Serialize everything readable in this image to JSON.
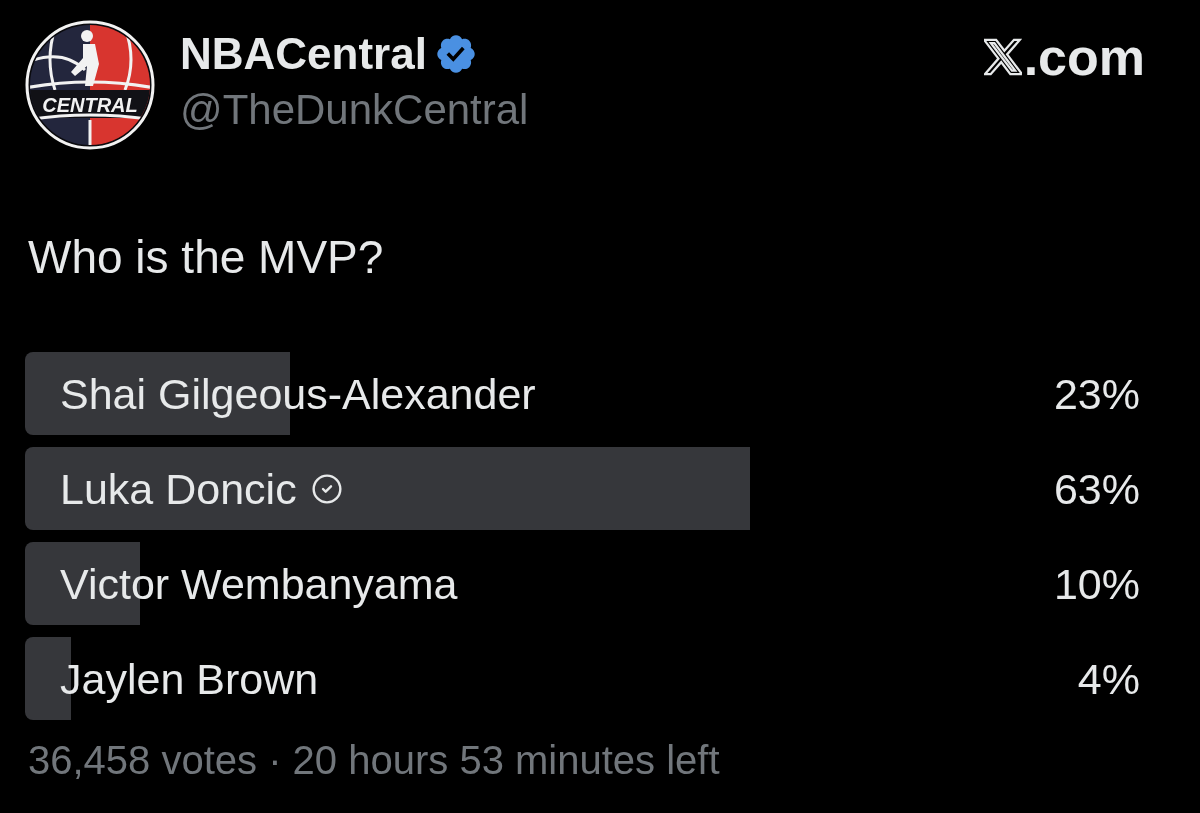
{
  "account": {
    "name": "NBACentral",
    "verified": true,
    "handle": "@TheDunkCentral",
    "avatar": {
      "text": "CENTRAL"
    }
  },
  "brand": {
    "text": ".com"
  },
  "poll": {
    "question": "Who is the MVP?",
    "options": [
      {
        "label": "Shai Gilgeous-Alexander",
        "percent": "23%",
        "level": 0.23,
        "selected": false
      },
      {
        "label": "Luka Doncic",
        "percent": "63%",
        "level": 0.63,
        "selected": true
      },
      {
        "label": "Victor Wembanyama",
        "percent": "10%",
        "level": 0.1,
        "selected": false
      },
      {
        "label": "Jaylen Brown",
        "percent": "4%",
        "level": 0.04,
        "selected": false
      }
    ],
    "summary": "36,458 votes · 20 hours 53 minutes left"
  }
}
